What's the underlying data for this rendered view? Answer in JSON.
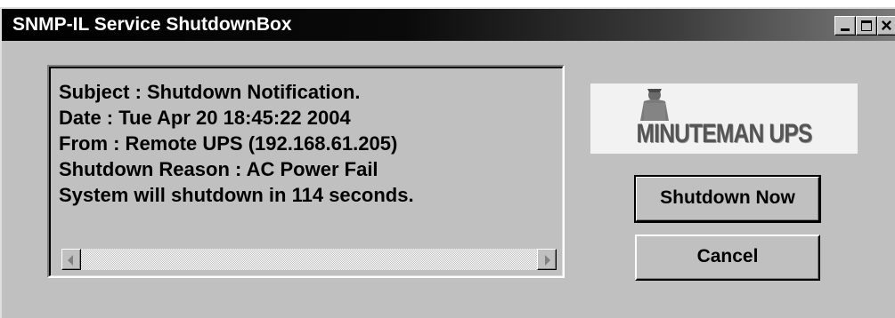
{
  "window": {
    "title": "SNMP-IL Service ShutdownBox",
    "controls": {
      "minimize": "_",
      "maximize": "",
      "close": "×"
    }
  },
  "message": {
    "lines": [
      "Subject : Shutdown Notification.",
      "Date : Tue Apr 20 18:45:22 2004",
      "From : Remote UPS (192.168.61.205)",
      "Shutdown Reason : AC Power Fail",
      "System will shutdown in 114 seconds."
    ],
    "countdown_seconds": 114
  },
  "logo": {
    "text": "MINUTEMAN UPS",
    "icon": "minuteman-figure-icon"
  },
  "buttons": {
    "shutdown_now": "Shutdown Now",
    "cancel": "Cancel"
  },
  "colors": {
    "dialog_bg": "#c0c0c0",
    "titlebar_start": "#000000",
    "titlebar_end": "#7a7a7a",
    "title_text": "#ffffff"
  }
}
